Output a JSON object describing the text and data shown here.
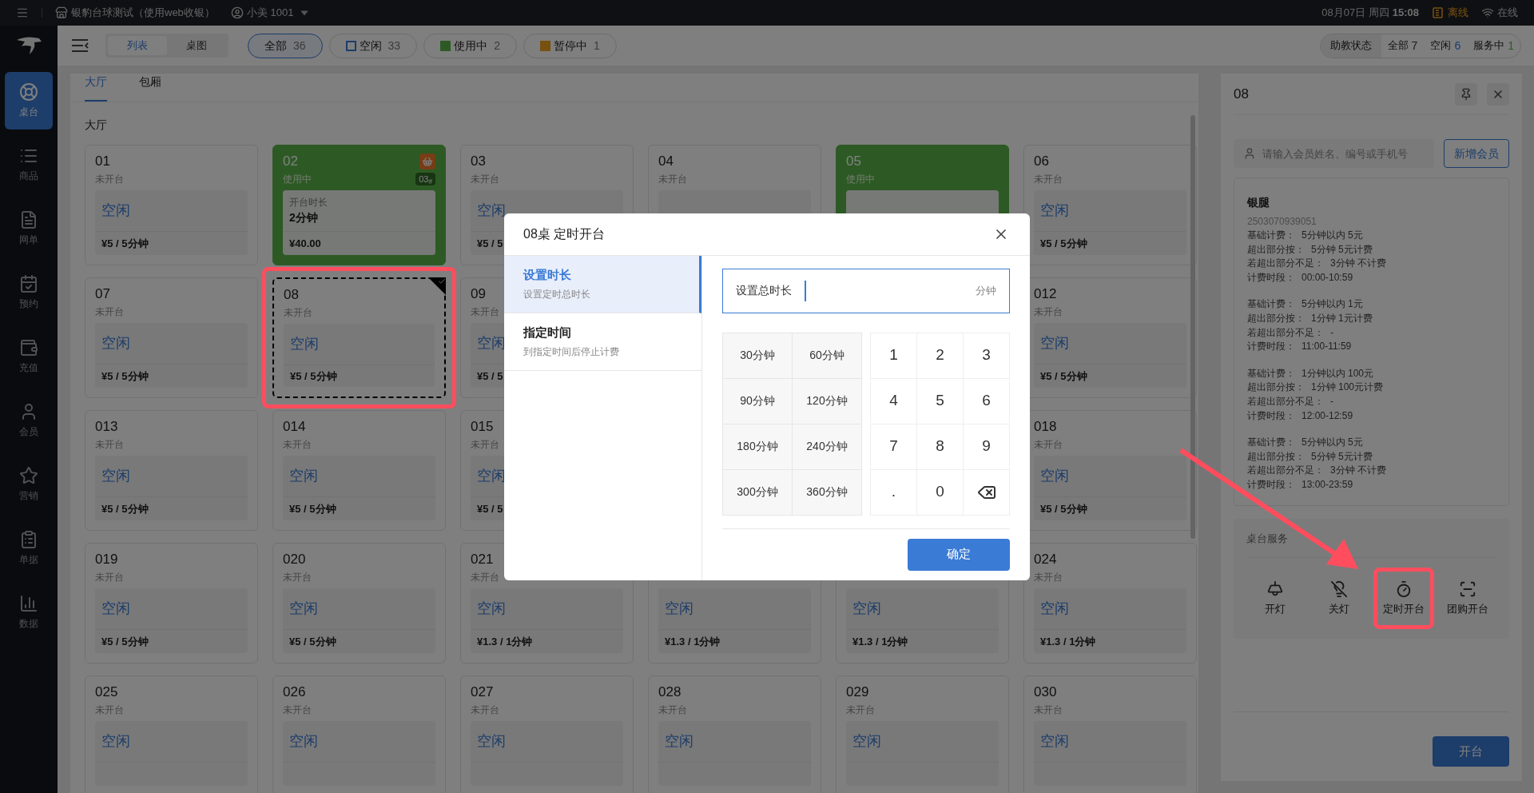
{
  "top_bar": {
    "store": "银豹台球测试（使用web收银）",
    "user": "小美 1001",
    "date": "08月07日 周四",
    "time": "15:08",
    "offline": "离线",
    "online": "在线"
  },
  "sidebar": [
    {
      "label": "桌台",
      "kind": "tables",
      "selected": true
    },
    {
      "label": "商品",
      "kind": "goods",
      "selected": false
    },
    {
      "label": "网单",
      "kind": "orders",
      "selected": false
    },
    {
      "label": "预约",
      "kind": "booking",
      "selected": false
    },
    {
      "label": "充值",
      "kind": "recharge",
      "selected": false
    },
    {
      "label": "会员",
      "kind": "member",
      "selected": false
    },
    {
      "label": "营销",
      "kind": "marketing",
      "selected": false
    },
    {
      "label": "单据",
      "kind": "bills",
      "selected": false
    },
    {
      "label": "数据",
      "kind": "data",
      "selected": false
    }
  ],
  "view_toggle": [
    {
      "label": "列表",
      "selected": true
    },
    {
      "label": "桌图",
      "selected": false
    }
  ],
  "filters": [
    {
      "label": "全部",
      "count": "36",
      "kind": "plain",
      "selected": true
    },
    {
      "label": "空闲",
      "count": "33",
      "kind": "outline",
      "color": "#1d3d6a",
      "selected": false
    },
    {
      "label": "使用中",
      "count": "2",
      "kind": "filled",
      "color": "#2d5a24",
      "selected": false
    },
    {
      "label": "暂停中",
      "count": "1",
      "kind": "filled",
      "color": "#785010",
      "selected": false
    }
  ],
  "assistant_status": {
    "title": "助教状态",
    "items": [
      {
        "label": "全部",
        "count": "7",
        "kind": "all"
      },
      {
        "label": "空闲",
        "count": "6",
        "kind": "idle"
      },
      {
        "label": "服务中",
        "count": "1",
        "kind": "serving"
      }
    ]
  },
  "area_tabs": [
    {
      "label": "大厅",
      "selected": true
    },
    {
      "label": "包厢",
      "selected": false
    }
  ],
  "section_title": "大厅",
  "table_rows": [
    {
      "tables": [
        {
          "number": "01",
          "status": "未开台",
          "kind": "idle",
          "label": "空闲",
          "price": "¥5 / 5分钟",
          "selected": false
        },
        {
          "number": "02",
          "status": "使用中",
          "kind": "busy",
          "badge": "03$_{#}$",
          "duration_label": "开台时长",
          "duration": "2分钟",
          "price": "¥40.00",
          "selected": false,
          "cart": true
        },
        {
          "number": "03",
          "status": "未开台",
          "kind": "idle",
          "label": "空闲",
          "price": "¥5 / 5",
          "selected": false
        },
        {
          "number": "04",
          "status": "未开台",
          "kind": "idle",
          "selected": false
        },
        {
          "number": "05",
          "status": "使用中",
          "kind": "busy",
          "selected": false
        },
        {
          "number": "06",
          "status": "未开台",
          "kind": "idle",
          "label": "空闲",
          "price": "¥5 / 5分钟",
          "selected": false
        }
      ]
    },
    {
      "tables": [
        {
          "number": "07",
          "status": "未开台",
          "kind": "idle",
          "label": "空闲",
          "price": "¥5 / 5分钟",
          "selected": false
        },
        {
          "number": "08",
          "status": "未开台",
          "kind": "idle",
          "label": "空闲",
          "price": "¥5 / 5分钟",
          "selected": true,
          "highlighted": true
        },
        {
          "number": "09",
          "status": "未开台",
          "kind": "idle",
          "label": "空闲",
          "price": "¥5 / 5",
          "selected": false
        },
        {
          "number": "012",
          "status": "未开台",
          "kind": "idle",
          "label": "空闲",
          "price": "¥5 / 5分钟",
          "selected": false
        }
      ]
    },
    {
      "tables": [
        {
          "number": "013",
          "status": "未开台",
          "kind": "idle",
          "label": "空闲",
          "price": "¥5 / 5分钟",
          "selected": false
        },
        {
          "number": "014",
          "status": "未开台",
          "kind": "idle",
          "label": "空闲",
          "price": "¥5 / 5分钟",
          "selected": false
        },
        {
          "number": "015",
          "status": "未开台",
          "kind": "idle",
          "label": "空闲",
          "price": "¥5 / 5",
          "selected": false
        },
        {
          "number": "018",
          "status": "未开台",
          "kind": "idle",
          "label": "空闲",
          "price": "¥5 / 5分钟",
          "selected": false
        }
      ]
    },
    {
      "tables": [
        {
          "number": "019",
          "status": "未开台",
          "kind": "idle",
          "label": "空闲",
          "price": "¥5 / 5分钟",
          "selected": false
        },
        {
          "number": "020",
          "status": "未开台",
          "kind": "idle",
          "label": "空闲",
          "price": "¥5 / 5分钟",
          "selected": false
        },
        {
          "number": "021",
          "status": "未开台",
          "kind": "idle",
          "label": "空闲",
          "price": "¥1.3 / 1分钟",
          "selected": false
        },
        {
          "kind": "idle",
          "label": "空闲",
          "price": "¥1.3 / 1分钟",
          "selected": false
        },
        {
          "kind": "idle",
          "label": "空闲",
          "price": "¥1.3 / 1分钟",
          "selected": false
        },
        {
          "number": "024",
          "status": "未开台",
          "kind": "idle",
          "label": "空闲",
          "price": "¥1.3 / 1分钟",
          "selected": false
        }
      ]
    },
    {
      "tables": [
        {
          "number": "025",
          "status": "未开台",
          "kind": "idle",
          "label": "空闲",
          "selected": false
        },
        {
          "number": "026",
          "status": "未开台",
          "kind": "idle",
          "label": "空闲",
          "selected": false
        },
        {
          "number": "027",
          "status": "未开台",
          "kind": "idle",
          "label": "空闲",
          "selected": false
        },
        {
          "number": "028",
          "status": "未开台",
          "kind": "idle",
          "label": "空闲",
          "selected": false
        },
        {
          "number": "029",
          "status": "未开台",
          "kind": "idle",
          "label": "空闲",
          "selected": false
        },
        {
          "number": "030",
          "status": "未开台",
          "kind": "idle",
          "label": "空闲",
          "selected": false
        }
      ]
    }
  ],
  "detail_panel": {
    "title": "08",
    "member_search": {
      "placeholder": "请输入会员姓名、编号或手机号"
    },
    "add_member": "新增会员",
    "plan": {
      "name": "银腿",
      "code": "2503070939051",
      "groups": [
        [
          {
            "label": "基础计费：",
            "value": "5分钟以内 5元"
          },
          {
            "label": "超出部分按：",
            "value": "5分钟 5元计费"
          },
          {
            "label": "若超出部分不足：",
            "value": "3分钟 不计费"
          },
          {
            "label": "计费时段：",
            "value": "00:00-10:59"
          }
        ],
        [
          {
            "label": "基础计费：",
            "value": "5分钟以内 1元"
          },
          {
            "label": "超出部分按：",
            "value": "1分钟 1元计费"
          },
          {
            "label": "若超出部分不足：",
            "value": "-"
          },
          {
            "label": "计费时段：",
            "value": "11:00-11:59"
          }
        ],
        [
          {
            "label": "基础计费：",
            "value": "1分钟以内 100元"
          },
          {
            "label": "超出部分按：",
            "value": "1分钟 100元计费"
          },
          {
            "label": "若超出部分不足：",
            "value": "-"
          },
          {
            "label": "计费时段：",
            "value": "12:00-12:59"
          }
        ],
        [
          {
            "label": "基础计费：",
            "value": "5分钟以内 5元"
          },
          {
            "label": "超出部分按：",
            "value": "5分钟 5元计费"
          },
          {
            "label": "若超出部分不足：",
            "value": "3分钟 不计费"
          },
          {
            "label": "计费时段：",
            "value": "13:00-23:59"
          }
        ]
      ]
    },
    "services_title": "桌台服务",
    "services": [
      {
        "label": "开灯",
        "kind": "light_on"
      },
      {
        "label": "关灯",
        "kind": "light_off"
      },
      {
        "label": "定时开台",
        "kind": "timer",
        "highlighted": true
      },
      {
        "label": "团购开台",
        "kind": "scan"
      }
    ],
    "open_button": "开台"
  },
  "dialog": {
    "title": "08桌 定时开台",
    "modes": [
      {
        "title": "设置时长",
        "subtitle": "设置定时总时长",
        "selected": true
      },
      {
        "title": "指定时间",
        "subtitle": "到指定时间后停止计费",
        "selected": false
      }
    ],
    "field": {
      "label": "设置总时长",
      "unit": "分钟",
      "focused": true
    },
    "presets": [
      "30分钟",
      "60分钟",
      "90分钟",
      "120分钟",
      "180分钟",
      "240分钟",
      "300分钟",
      "360分钟"
    ],
    "keypad": [
      {
        "kind": "key",
        "label": "1"
      },
      {
        "kind": "key",
        "label": "2"
      },
      {
        "kind": "key",
        "label": "3"
      },
      {
        "kind": "key",
        "label": "4"
      },
      {
        "kind": "key",
        "label": "5"
      },
      {
        "kind": "key",
        "label": "6"
      },
      {
        "kind": "key",
        "label": "7"
      },
      {
        "kind": "key",
        "label": "8"
      },
      {
        "kind": "key",
        "label": "9"
      },
      {
        "kind": "key",
        "label": "."
      },
      {
        "kind": "key",
        "label": "0"
      },
      {
        "kind": "backspace"
      }
    ],
    "confirm": "确定"
  }
}
